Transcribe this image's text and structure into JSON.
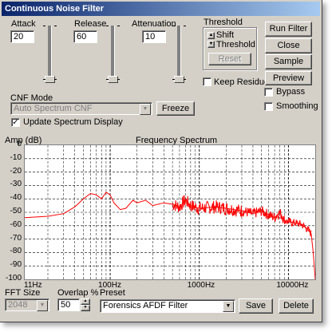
{
  "window": {
    "title": "Continuous Noise Filter"
  },
  "sliders": [
    {
      "label": "Attack",
      "value": "20",
      "level": 0.0
    },
    {
      "label": "Release",
      "value": "60",
      "level": 0.0
    },
    {
      "label": "Attenuation",
      "value": "10",
      "level": 0.0
    }
  ],
  "threshold": {
    "title": "Threshold",
    "shift_label": "Shift",
    "threshold_label": "Threshold",
    "reset_label": "Reset"
  },
  "buttons": {
    "run_filter": "Run Filter",
    "close": "Close",
    "sample_noise": "Sample Noise",
    "preview": "Preview",
    "freeze": "Freeze",
    "save": "Save",
    "delete": "Delete"
  },
  "options": {
    "keep_residue": {
      "label": "Keep Residue",
      "checked": false
    },
    "bypass": {
      "label": "Bypass",
      "checked": false
    },
    "smoothing": {
      "label": "Smoothing",
      "checked": false
    },
    "update_spectrum": {
      "label": "Update Spectrum Display",
      "checked": true
    }
  },
  "cnf_mode": {
    "label": "CNF Mode",
    "value": "Auto Spectrum CNF"
  },
  "fft": {
    "label": "FFT Size",
    "value": "2048"
  },
  "overlap": {
    "label": "Overlap %",
    "value": "50"
  },
  "preset": {
    "label": "Preset",
    "value": "Forensics AFDF Filter"
  },
  "chart_data": {
    "type": "line",
    "title": "Frequency Spectrum",
    "ylabel": "Amp (dB)",
    "xlabel": "",
    "x_scale": "log",
    "xlim": [
      11,
      20000
    ],
    "ylim": [
      -100,
      0
    ],
    "grid": true,
    "y_ticks": [
      "0",
      "-10",
      "-20",
      "-30",
      "-40",
      "-50",
      "-60",
      "-70",
      "-80",
      "-90",
      "-100"
    ],
    "x_ticks": [
      "11Hz",
      "100Hz",
      "1000Hz",
      "10000Hz"
    ],
    "series_color": "#ff0000",
    "x": [
      11,
      20,
      30,
      40,
      50,
      60,
      70,
      80,
      90,
      100,
      110,
      130,
      150,
      180,
      200,
      250,
      300,
      400,
      500,
      600,
      700,
      800,
      1000,
      1500,
      2000,
      3000,
      4000,
      5000,
      6000,
      7000,
      8000,
      9000,
      10000,
      12000,
      14000,
      16000,
      18000,
      19000,
      20000
    ],
    "y": [
      -54,
      -53,
      -51,
      -46,
      -40,
      -36,
      -37,
      -40,
      -35,
      -37,
      -43,
      -48,
      -47,
      -41,
      -43,
      -41,
      -45,
      -43,
      -44,
      -46,
      -41,
      -45,
      -47,
      -46,
      -47,
      -49,
      -51,
      -49,
      -52,
      -54,
      -50,
      -56,
      -57,
      -58,
      -59,
      -62,
      -66,
      -80,
      -100
    ]
  }
}
